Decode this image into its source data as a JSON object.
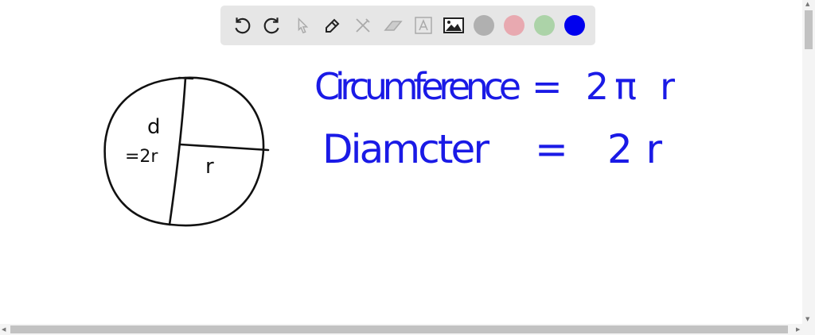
{
  "toolbar": {
    "tools": [
      "undo-icon",
      "redo-icon",
      "select-icon",
      "pen-icon",
      "tools-icon",
      "eraser-icon",
      "text-icon",
      "image-icon"
    ],
    "colors": [
      "#b0b0b0",
      "#e8a9b0",
      "#acd3a8",
      "#0000ee"
    ],
    "selected_color": "#0000ee"
  },
  "board": {
    "ink_black": "#111111",
    "ink_blue": "#1a1ae6",
    "diagram": {
      "label_d": "d",
      "label_2r": "=2r",
      "label_r": "r"
    },
    "equations": [
      {
        "left": "Circumference",
        "right": "= 2π r"
      },
      {
        "left": "Diamcter",
        "right": "= 2r"
      }
    ]
  }
}
